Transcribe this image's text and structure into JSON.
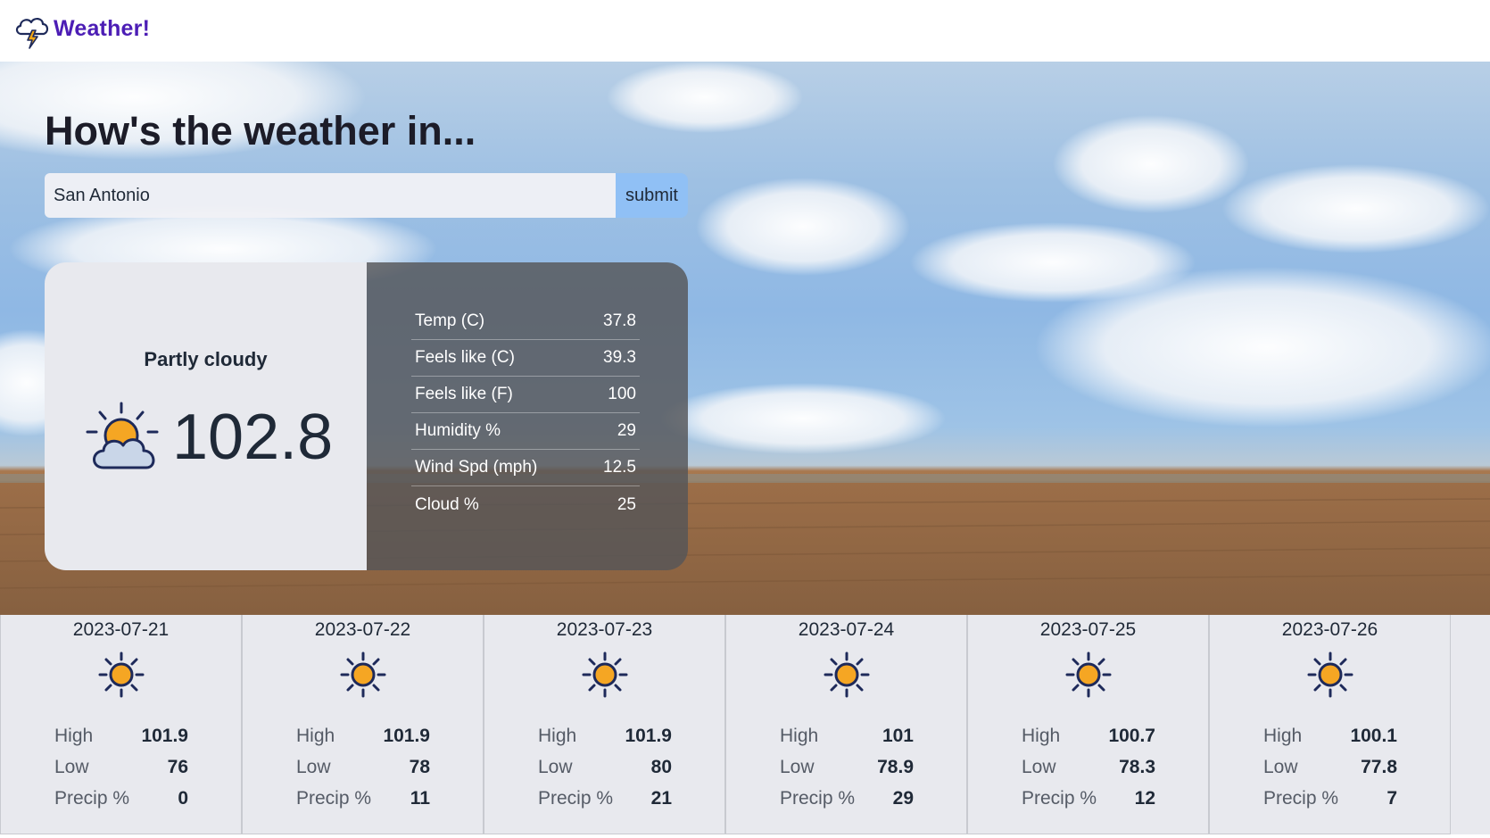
{
  "header": {
    "brand": "Weather!",
    "logo_icon": "storm-cloud-icon",
    "brand_color": "#4c1db5"
  },
  "hero": {
    "title": "How's the weather in...",
    "search": {
      "value": "San Antonio",
      "placeholder": ""
    },
    "submit_label": "submit"
  },
  "current": {
    "condition": "Partly cloudy",
    "icon": "partly-cloudy-icon",
    "temp_f": "102.8",
    "stats": [
      {
        "label": "Temp (C)",
        "value": "37.8"
      },
      {
        "label": "Feels like (C)",
        "value": "39.3"
      },
      {
        "label": "Feels like (F)",
        "value": "100"
      },
      {
        "label": "Humidity %",
        "value": "29"
      },
      {
        "label": "Wind Spd (mph)",
        "value": "12.5"
      },
      {
        "label": "Cloud %",
        "value": "25"
      }
    ]
  },
  "forecast": {
    "labels": {
      "high": "High",
      "low": "Low",
      "precip": "Precip %"
    },
    "days": [
      {
        "date": "2023-07-21",
        "icon": "sun-icon",
        "high": "101.9",
        "low": "76",
        "precip": "0"
      },
      {
        "date": "2023-07-22",
        "icon": "sun-icon",
        "high": "101.9",
        "low": "78",
        "precip": "11"
      },
      {
        "date": "2023-07-23",
        "icon": "sun-icon",
        "high": "101.9",
        "low": "80",
        "precip": "21"
      },
      {
        "date": "2023-07-24",
        "icon": "sun-icon",
        "high": "101",
        "low": "78.9",
        "precip": "29"
      },
      {
        "date": "2023-07-25",
        "icon": "sun-icon",
        "high": "100.7",
        "low": "78.3",
        "precip": "12"
      },
      {
        "date": "2023-07-26",
        "icon": "sun-icon",
        "high": "100.1",
        "low": "77.8",
        "precip": "7"
      }
    ]
  }
}
